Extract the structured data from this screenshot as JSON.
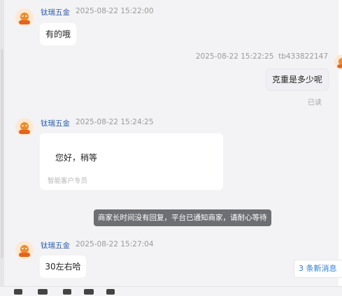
{
  "messages": [
    {
      "sender": "钛瑞五金",
      "time": "2025-08-22 15:22:00",
      "text": "有的哦"
    },
    {
      "time": "2025-08-22 15:22:25",
      "sender": "tb433822147",
      "text": "克重是多少呢",
      "status": "已读"
    },
    {
      "sender": "钛瑞五金",
      "time": "2025-08-22 15:24:25",
      "text": "您好，稍等",
      "caption": "智能客户专员"
    },
    {
      "sender": "钛瑞五金",
      "time": "2025-08-22 15:27:04",
      "text": "30左右哈"
    }
  ],
  "system_notice": "商家长时间没有回复，平台已通知商家，请耐心等待",
  "new_messages_label": "3 条新消息",
  "colors": {
    "sender": "#2a5db0",
    "accent": "#2a7fd8",
    "background": "#f3f3f5",
    "notice": "#6d6f73"
  }
}
